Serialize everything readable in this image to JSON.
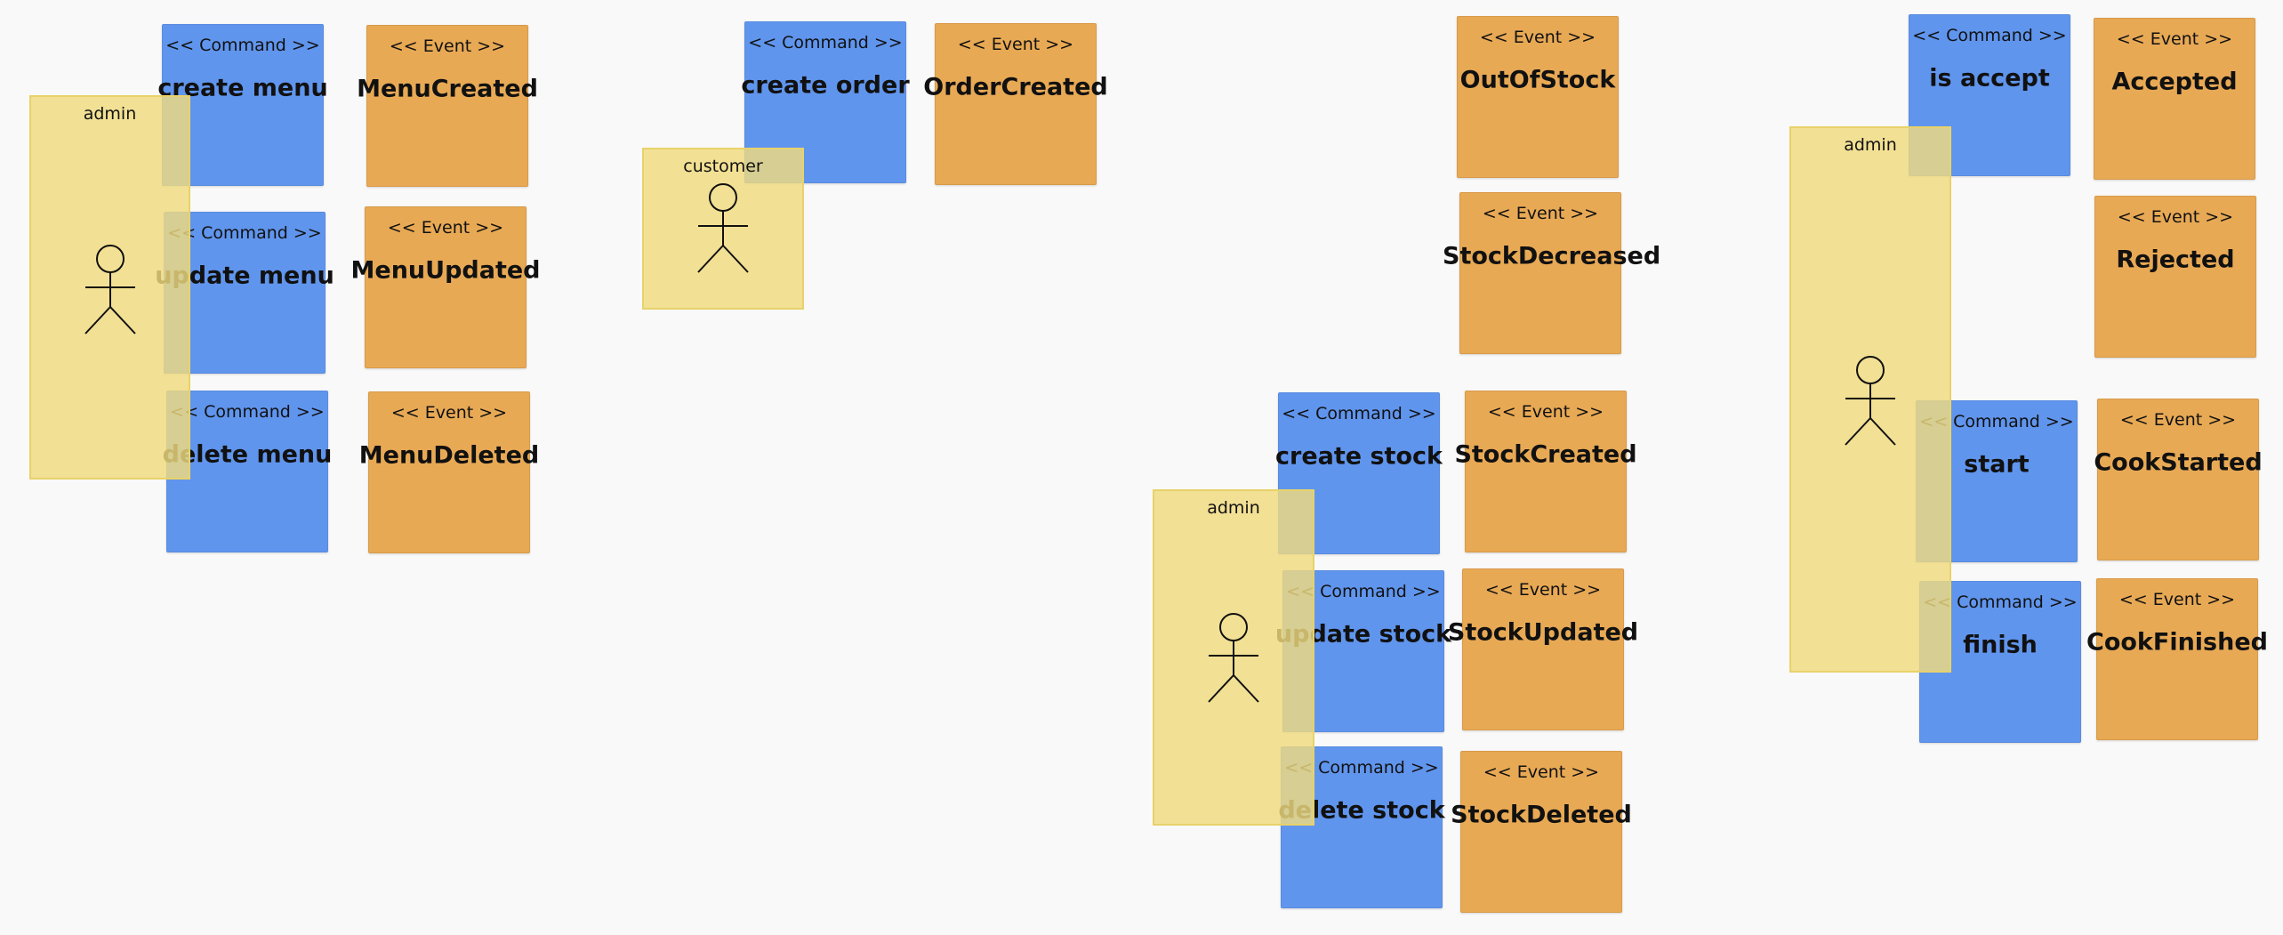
{
  "colors": {
    "canvas": "#f9f9f9",
    "command": "#6095ed",
    "event": "#e8a955",
    "actor": "#f0da7e"
  },
  "icons": [
    "stick-figure-icon"
  ],
  "commands": [
    {
      "stereotype": "<< Command >>",
      "label": "create menu"
    },
    {
      "stereotype": "<< Command >>",
      "label": "update menu"
    },
    {
      "stereotype": "<< Command >>",
      "label": "delete menu"
    },
    {
      "stereotype": "<< Command >>",
      "label": "create order"
    },
    {
      "stereotype": "<< Command >>",
      "label": "create stock"
    },
    {
      "stereotype": "<< Command >>",
      "label": "update stock"
    },
    {
      "stereotype": "<< Command >>",
      "label": "delete stock"
    },
    {
      "stereotype": "<< Command >>",
      "label": "is accept"
    },
    {
      "stereotype": "<< Command >>",
      "label": "start"
    },
    {
      "stereotype": "<< Command >>",
      "label": "finish"
    }
  ],
  "events": [
    {
      "stereotype": "<< Event >>",
      "label": "MenuCreated"
    },
    {
      "stereotype": "<< Event >>",
      "label": "MenuUpdated"
    },
    {
      "stereotype": "<< Event >>",
      "label": "MenuDeleted"
    },
    {
      "stereotype": "<< Event >>",
      "label": "OrderCreated"
    },
    {
      "stereotype": "<< Event >>",
      "label": "OutOfStock"
    },
    {
      "stereotype": "<< Event >>",
      "label": "StockDecreased"
    },
    {
      "stereotype": "<< Event >>",
      "label": "StockCreated"
    },
    {
      "stereotype": "<< Event >>",
      "label": "StockUpdated"
    },
    {
      "stereotype": "<< Event >>",
      "label": "StockDeleted"
    },
    {
      "stereotype": "<< Event >>",
      "label": "Accepted"
    },
    {
      "stereotype": "<< Event >>",
      "label": "Rejected"
    },
    {
      "stereotype": "<< Event >>",
      "label": "CookStarted"
    },
    {
      "stereotype": "<< Event >>",
      "label": "CookFinished"
    }
  ],
  "actors": [
    {
      "label": "admin"
    },
    {
      "label": "customer"
    },
    {
      "label": "admin"
    },
    {
      "label": "admin"
    }
  ]
}
